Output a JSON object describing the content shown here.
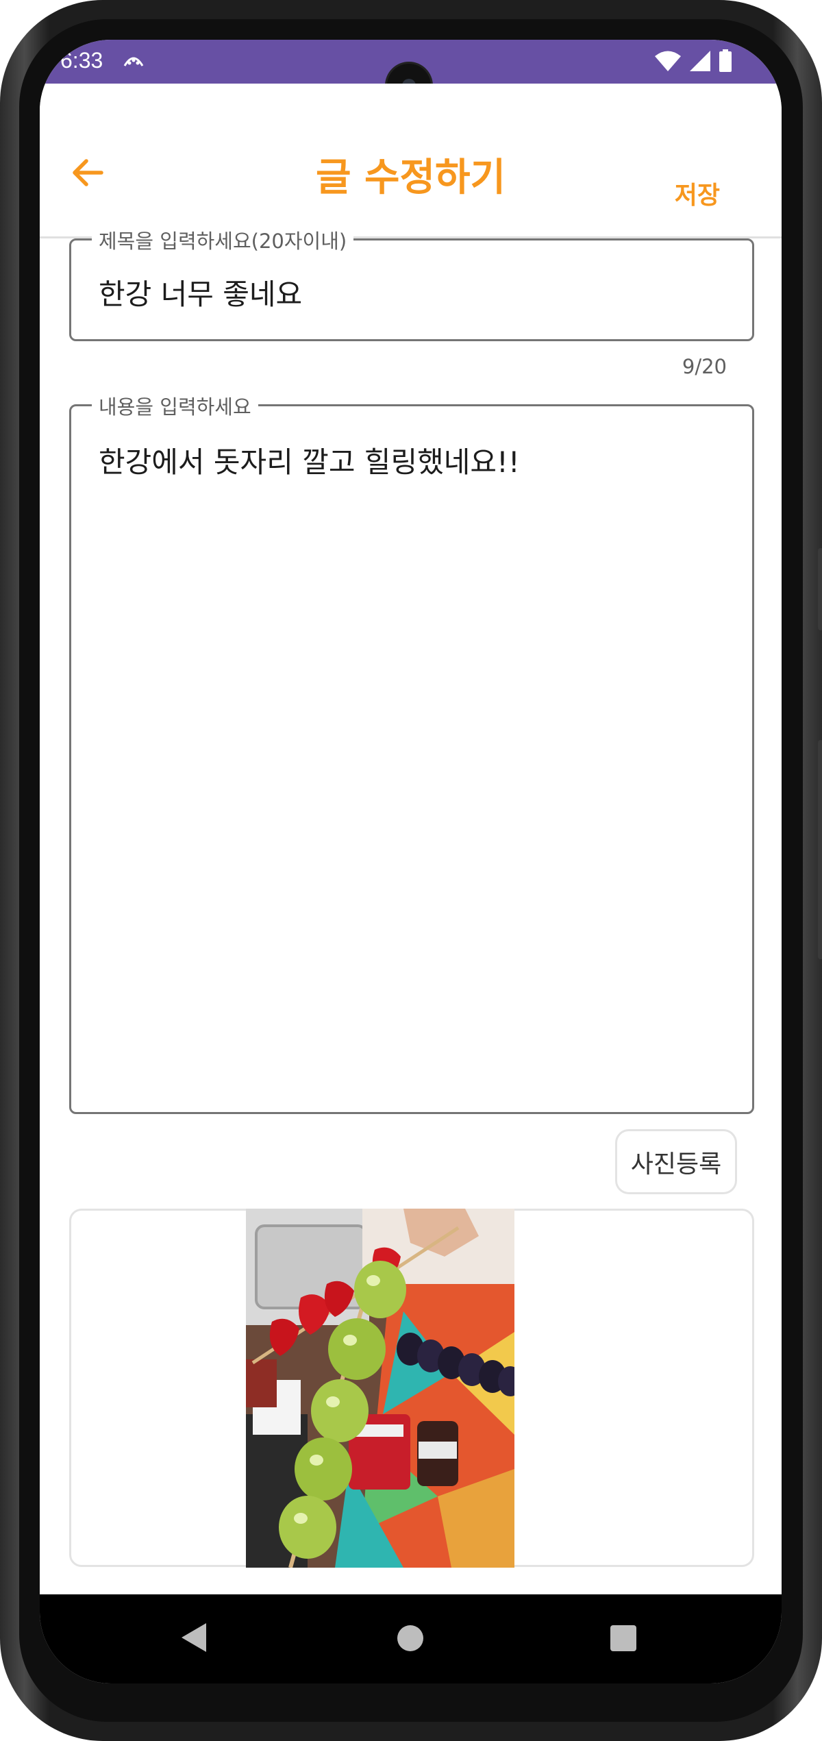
{
  "status_bar": {
    "time": "6:33",
    "color": "#6750a4"
  },
  "app_bar": {
    "title": "글 수정하기",
    "save_label": "저장",
    "accent": "#f7971e"
  },
  "title_field": {
    "label": "제목을 입력하세요(20자이내)",
    "value": "한강 너무 좋네요",
    "counter": "9/20"
  },
  "content_field": {
    "label": "내용을 입력하세요",
    "value": "한강에서 돗자리 깔고 힐링했네요!!"
  },
  "photo_button": {
    "label": "사진등록"
  },
  "photo": {
    "subject": "tanghulu skewers (candied strawberries, green grapes, black grapes)"
  }
}
